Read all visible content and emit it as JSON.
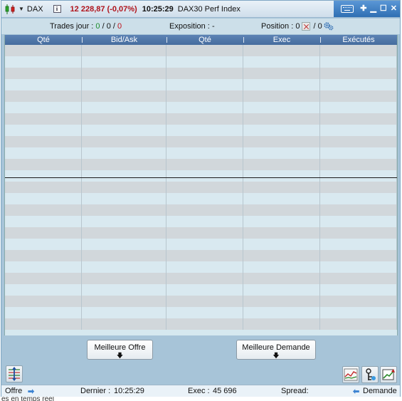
{
  "titlebar": {
    "symbol": "DAX",
    "info_icon_label": "i",
    "price_change": "12 228,87 (-0,07%)",
    "time": "10:25:29",
    "instrument_name": "DAX30 Perf Index",
    "icons": [
      "candlestick-chart-icon",
      "dropdown-icon",
      "info-icon",
      "keyboard-icon",
      "pin-icon",
      "minimize-icon",
      "maximize-icon",
      "close-icon"
    ]
  },
  "stats": {
    "trades_label": "Trades jour :",
    "trades_a": "0",
    "trades_sep1": "/",
    "trades_b": "0",
    "trades_sep2": "/",
    "trades_c": "0",
    "exposition_label": "Exposition :",
    "exposition_value": "-",
    "position_label": "Position :",
    "position_value": "0",
    "position_sep": "/",
    "position_value2": "0"
  },
  "ladder": {
    "columns": [
      "Qté",
      "Bid/Ask",
      "Qté",
      "Exec",
      "Exécutés"
    ],
    "row_count": 25
  },
  "buttons": {
    "best_offer": "Meilleure Offre",
    "best_demand": "Meilleure Demande",
    "arrow": "🡇"
  },
  "statusbar": {
    "offre_label": "Offre",
    "offre_arrow": "➡",
    "dernier_label": "Dernier :",
    "dernier_value": "10:25:29",
    "exec_label": "Exec :",
    "exec_value": "45 696",
    "spread_label": "Spread:",
    "demande_arrow": "⬅",
    "demande_label": "Demande"
  },
  "underlying_text": "es en temps réel",
  "colors": {
    "price": "#b0131b",
    "trade_positive": "#1b8c2a",
    "trade_negative": "#c0111a",
    "header": "#456c9e",
    "window_bg": "#a7c4d8"
  }
}
